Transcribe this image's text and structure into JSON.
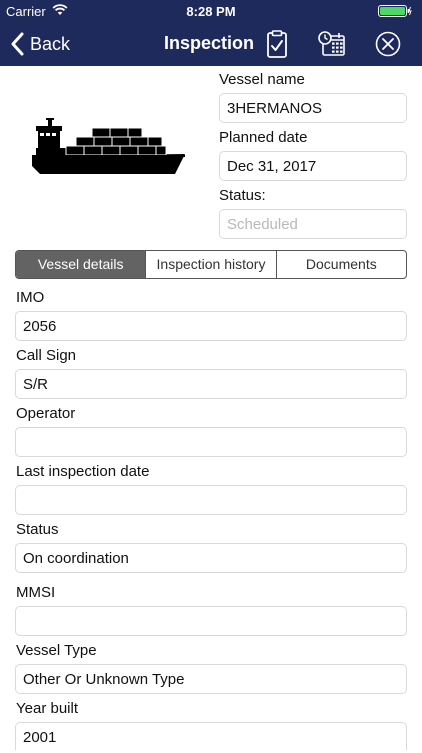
{
  "status_bar": {
    "carrier": "Carrier",
    "time": "8:28 PM"
  },
  "nav": {
    "back_label": "Back",
    "title": "Inspection",
    "icons": [
      "checklist-icon",
      "calendar-schedule-icon",
      "close-circle-icon"
    ],
    "bar_color": "#1f2a5c"
  },
  "header": {
    "vessel_name_label": "Vessel name",
    "vessel_name_value": "3HERMANOS",
    "planned_date_label": "Planned date",
    "planned_date_value": "Dec 31, 2017",
    "status_label": "Status:",
    "status_placeholder": "Scheduled"
  },
  "tabs": {
    "items": [
      "Vessel details",
      "Inspection history",
      "Documents"
    ],
    "active": "Vessel details"
  },
  "details": {
    "imo_label": "IMO",
    "imo_value": "2056",
    "call_sign_label": "Call Sign",
    "call_sign_value": "S/R",
    "operator_label": "Operator",
    "operator_value": "",
    "last_inspection_label": "Last inspection date",
    "last_inspection_value": "",
    "status_label": "Status",
    "status_value": "On coordination",
    "mmsi_label": "MMSI",
    "mmsi_value": "",
    "vessel_type_label": "Vessel Type",
    "vessel_type_value": "Other Or Unknown Type",
    "year_built_label": "Year built",
    "year_built_value": "2001"
  }
}
